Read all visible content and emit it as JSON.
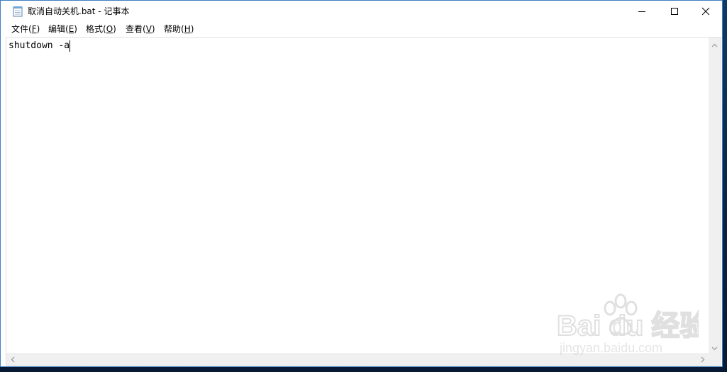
{
  "window": {
    "title": "取消自动关机.bat - 记事本"
  },
  "menubar": {
    "items": [
      {
        "label": "文件(",
        "key": "F",
        "suffix": ")"
      },
      {
        "label": "编辑(",
        "key": "E",
        "suffix": ")"
      },
      {
        "label": "格式(",
        "key": "O",
        "suffix": ")"
      },
      {
        "label": "查看(",
        "key": "V",
        "suffix": ")"
      },
      {
        "label": "帮助(",
        "key": "H",
        "suffix": ")"
      }
    ]
  },
  "editor": {
    "content": "shutdown -a"
  },
  "watermark": {
    "brand": "Bai du 经验",
    "url": "jingyan.baidu.com"
  },
  "icons": {
    "app": "notepad-icon",
    "minimize": "minimize-icon",
    "maximize": "maximize-icon",
    "close": "close-icon"
  },
  "colors": {
    "window_border": "#3f7fc2",
    "scrollbar": "#f0f0f0"
  }
}
